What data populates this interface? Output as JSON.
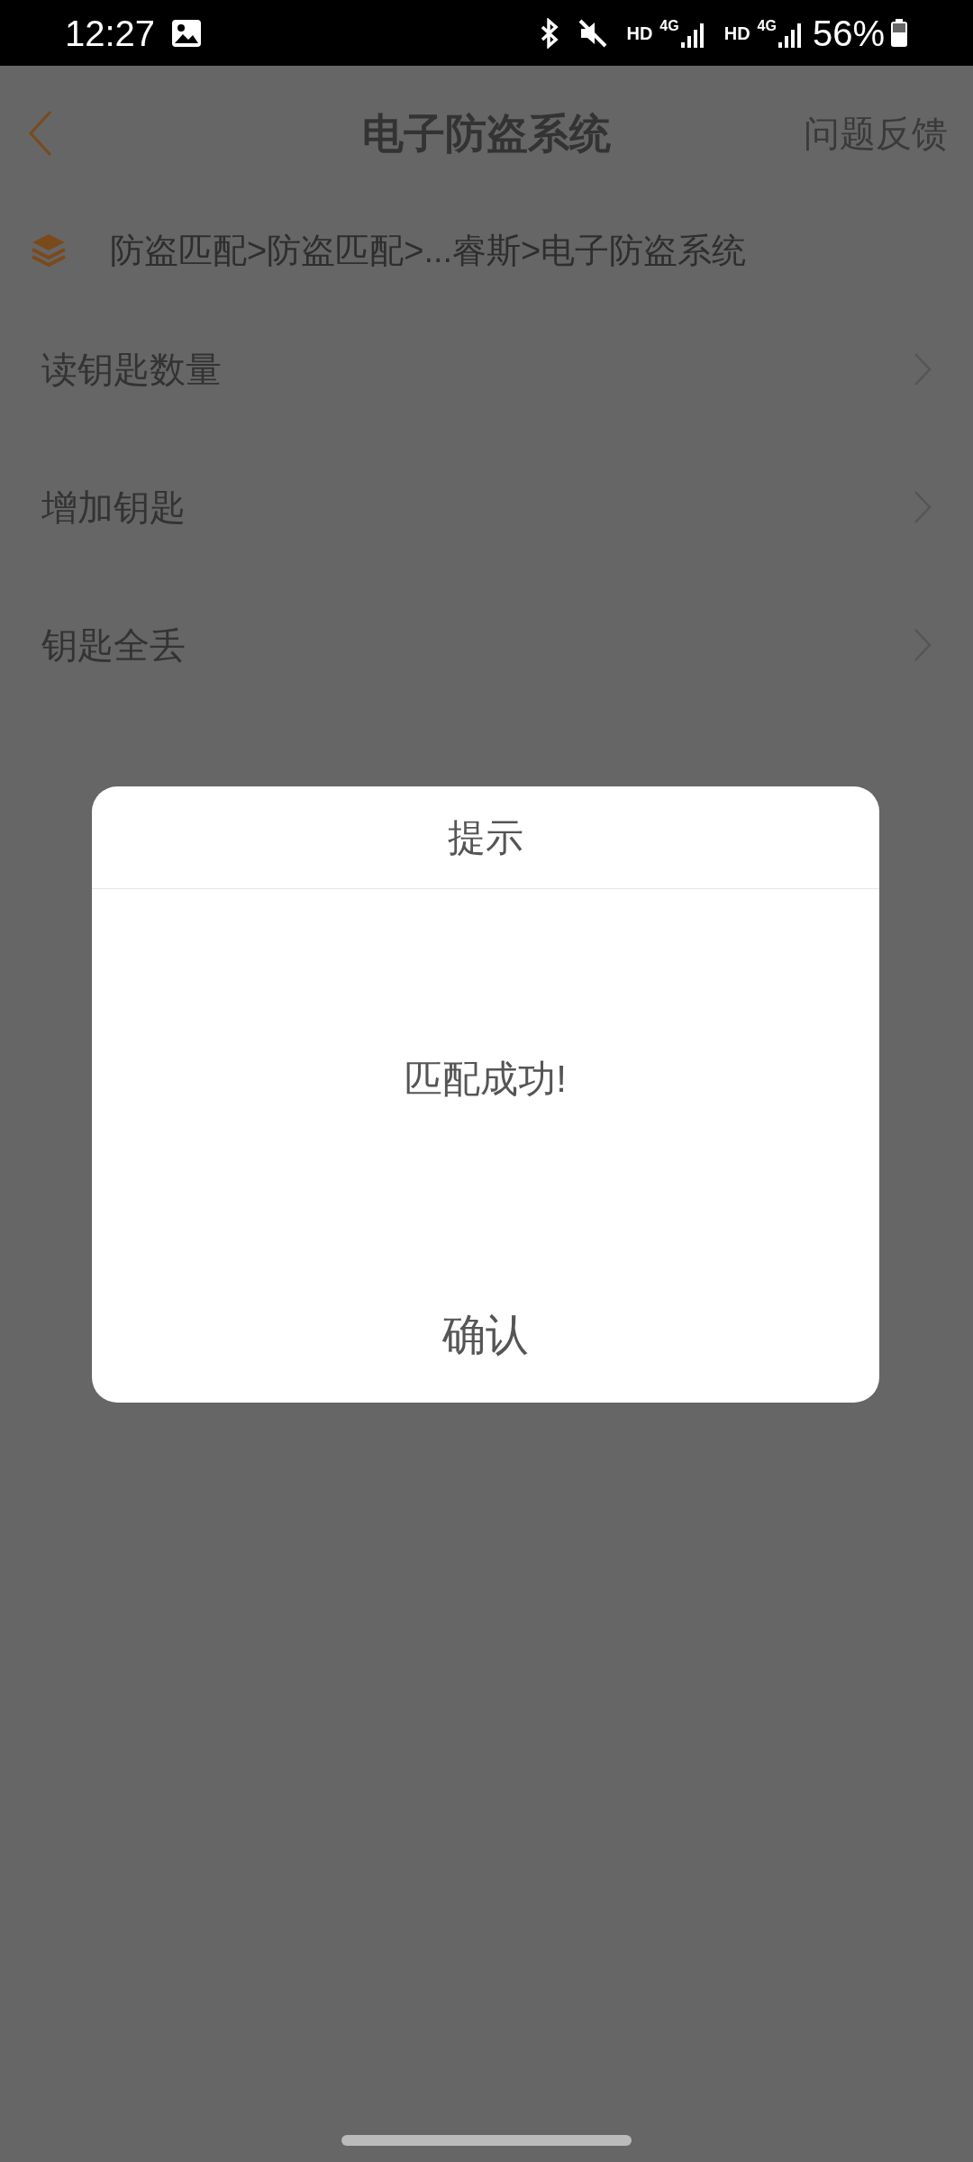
{
  "status_bar": {
    "time": "12:27",
    "indicators": [
      {
        "kind": "hd",
        "text": "HD"
      },
      {
        "kind": "net",
        "text": "4G"
      },
      {
        "kind": "hd",
        "text": "HD"
      },
      {
        "kind": "net",
        "text": "4G"
      }
    ],
    "battery": "56%"
  },
  "header": {
    "title": "电子防盗系统",
    "action": "问题反馈"
  },
  "breadcrumb": "防盗匹配>防盗匹配>...睿斯>电子防盗系统",
  "menu_items": [
    {
      "label": "读钥匙数量"
    },
    {
      "label": "增加钥匙"
    },
    {
      "label": "钥匙全丢"
    }
  ],
  "dialog": {
    "title": "提示",
    "message": "匹配成功!",
    "confirm": "确认"
  }
}
